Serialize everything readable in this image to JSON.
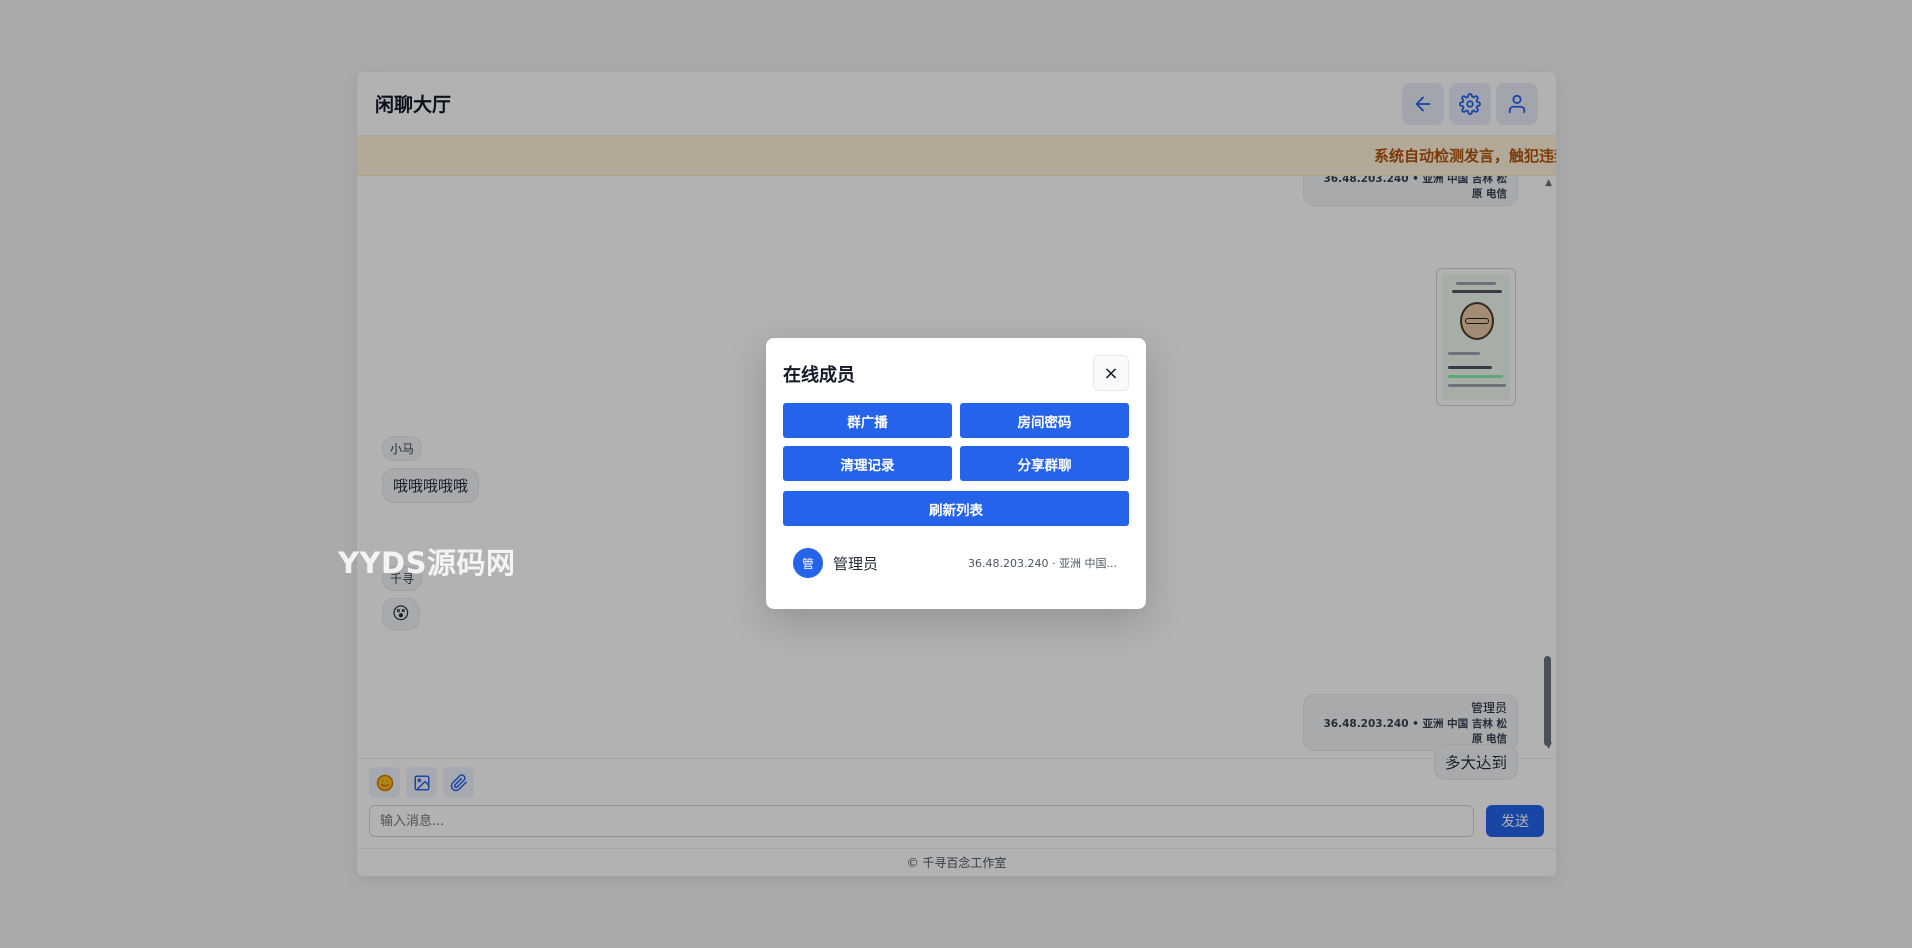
{
  "header": {
    "title": "闲聊大厅"
  },
  "notice": "系统自动检测发言，触犯违禁",
  "messages": {
    "top_meta_loc": "36.48.203.240 • 亚洲 中国 吉林 松原 电信",
    "msg1": {
      "sender": "小马",
      "text": "哦哦哦哦哦"
    },
    "msg2": {
      "sender": "千寻",
      "emoji": "😵"
    },
    "msg3": {
      "sender": "管理员",
      "location": "36.48.203.240 • 亚洲 中国 吉林 松原 电信",
      "text": "多大达到"
    }
  },
  "composer": {
    "placeholder": "输入消息...",
    "send_label": "发送"
  },
  "footer": "© 千寻百念工作室",
  "watermark": "YYDS源码网",
  "modal": {
    "title": "在线成员",
    "close_label": "×",
    "buttons": {
      "broadcast": "群广播",
      "room_password": "房间密码",
      "clear_history": "清理记录",
      "share_group": "分享群聊",
      "refresh_list": "刷新列表"
    },
    "members": [
      {
        "avatar_char": "管",
        "name": "管理员",
        "info": "36.48.203.240 · 亚洲 中国..."
      }
    ]
  },
  "colors": {
    "accent": "#2563eb",
    "notice_text": "#b45309",
    "notice_bg": "#fff3dc"
  }
}
